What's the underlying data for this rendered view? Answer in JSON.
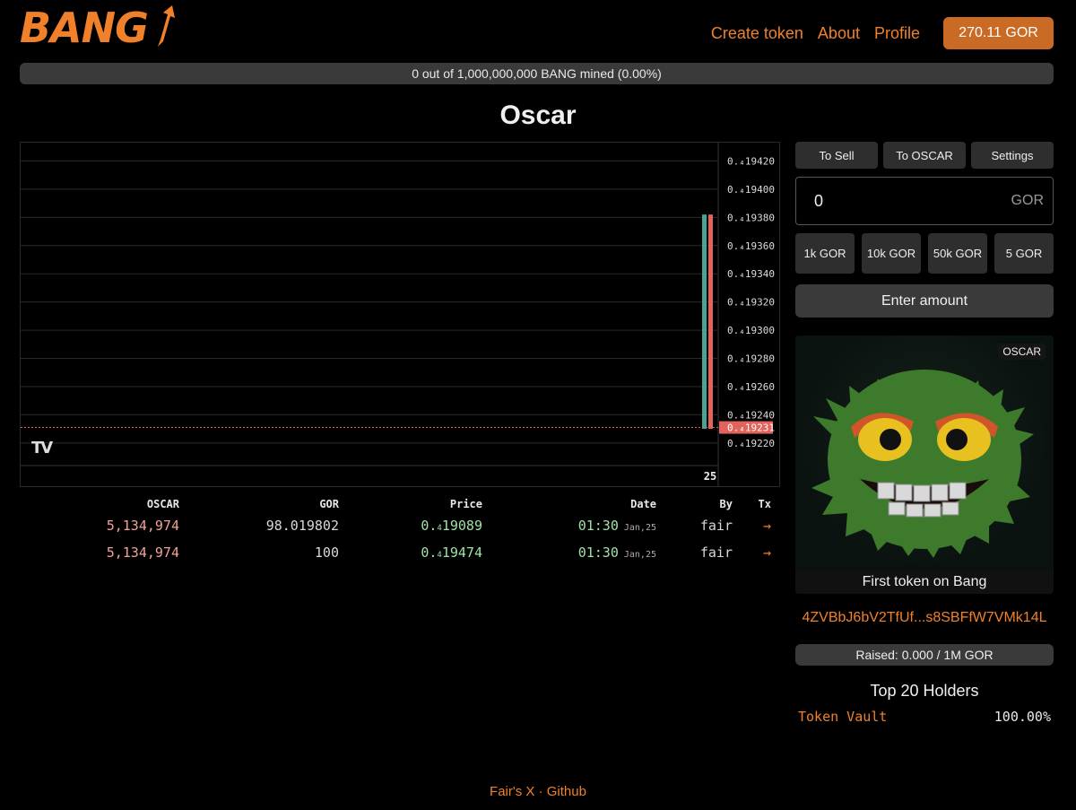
{
  "brand": {
    "logo_text": "BANG"
  },
  "nav": {
    "create_token": "Create token",
    "about": "About",
    "profile": "Profile",
    "balance": "270.11 GOR"
  },
  "mined": {
    "text": "0 out of 1,000,000,000 BANG mined (0.00%)",
    "fraction": 0
  },
  "token": {
    "title": "Oscar",
    "ticker": "OSCAR",
    "description": "First token on Bang",
    "address": "4ZVBbJ6bV2TfUf...s8SBFfW7VMk14L"
  },
  "chart_data": {
    "type": "candlestick",
    "x_tick_labels": [
      "25"
    ],
    "y_tick_labels": [
      "0.₄19420",
      "0.₄19400",
      "0.₄19380",
      "0.₄19360",
      "0.₄19340",
      "0.₄19320",
      "0.₄19300",
      "0.₄19280",
      "0.₄19260",
      "0.₄19240",
      "0.₄19220"
    ],
    "y_ticks": [
      1.1942e-05,
      1.194e-05,
      1.1938e-05,
      1.1936e-05,
      1.1934e-05,
      1.1932e-05,
      1.193e-05,
      1.1928e-05,
      1.1926e-05,
      1.1924e-05,
      1.1922e-05
    ],
    "ylim": [
      1.19204e-05,
      1.19433e-05
    ],
    "candles": [
      {
        "open": 1.1923e-05,
        "close": 1.19382e-05,
        "color": "#4ca393"
      },
      {
        "open": 1.19382e-05,
        "close": 1.1923e-05,
        "color": "#e0645c"
      }
    ],
    "last_price": 1.19231e-05,
    "last_price_label": "0.₄19231",
    "grid": true
  },
  "trades": {
    "headers": [
      "OSCAR",
      "GOR",
      "Price",
      "Date",
      "By",
      "Tx"
    ],
    "rows": [
      {
        "amount": "5,134,974",
        "gor": "98.019802",
        "price_prefix": "0.",
        "price_sub": "4",
        "price_rest": "19089",
        "time": "01:30",
        "date": "Jan,25",
        "by": "fair",
        "tx": "→"
      },
      {
        "amount": "5,134,974",
        "gor": "100",
        "price_prefix": "0.",
        "price_sub": "4",
        "price_rest": "19474",
        "time": "01:30",
        "date": "Jan,25",
        "by": "fair",
        "tx": "→"
      }
    ]
  },
  "trade_panel": {
    "tabs": [
      "To Sell",
      "To OSCAR",
      "Settings"
    ],
    "amount_value": "0",
    "amount_unit": "GOR",
    "presets": [
      "1k GOR",
      "10k GOR",
      "50k GOR",
      "5 GOR"
    ],
    "submit_label": "Enter amount"
  },
  "raised": {
    "text": "Raised: 0.000 / 1M GOR",
    "fraction": 0
  },
  "holders": {
    "title": "Top 20 Holders",
    "items": [
      {
        "name": "Token Vault",
        "pct": "100.00%"
      }
    ]
  },
  "footer": {
    "link1": "Fair's X",
    "separator": "·",
    "link2": "Github"
  },
  "colors": {
    "accent": "#f0812a",
    "up": "#4ca393",
    "down": "#e0645c"
  }
}
